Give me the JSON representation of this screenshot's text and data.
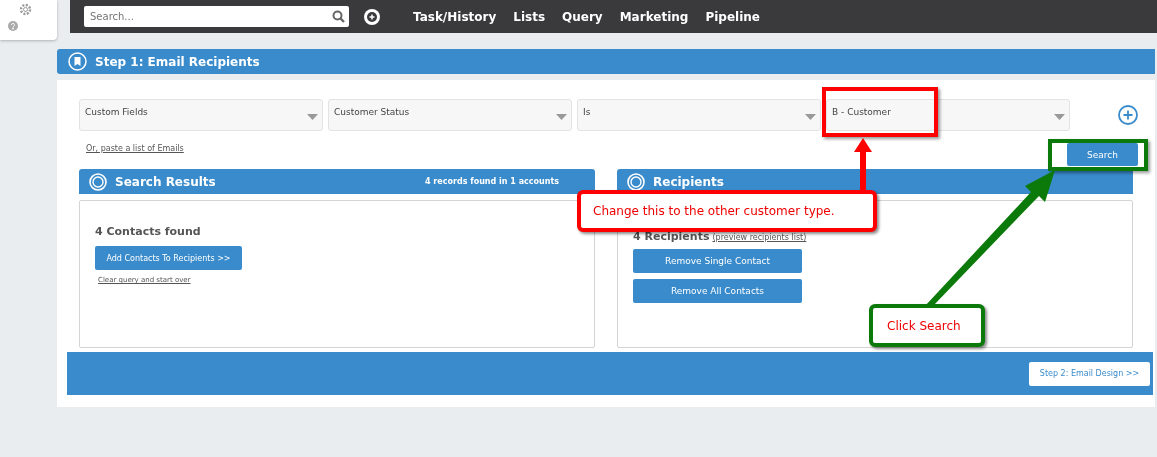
{
  "top_bar": {
    "search": {
      "placeholder": "Search..."
    },
    "nav": [
      "Task/History",
      "Lists",
      "Query",
      "Marketing",
      "Pipeline"
    ]
  },
  "step_header": {
    "title": "Step 1: Email Recipients"
  },
  "filters": [
    {
      "value": "Custom Fields"
    },
    {
      "value": "Customer Status"
    },
    {
      "value": "Is"
    },
    {
      "value": "B - Customer"
    }
  ],
  "paste_link": "Or, paste a list of Emails",
  "search_button": "Search",
  "results_panel": {
    "title": "Search Results",
    "summary": "4 records found in 1 accounts",
    "found": "4 Contacts found",
    "add_button": "Add Contacts To Recipients >>",
    "clear_link": "Clear query and start over"
  },
  "recipients_panel": {
    "title": "Recipients",
    "count": "4 Recipients",
    "preview_link": "(preview recipients list)",
    "buttons": [
      "Remove Single Contact",
      "Remove All Contacts"
    ]
  },
  "next_button": "Step 2: Email Design >>",
  "annotations": [
    {
      "kind": "red",
      "text": "Change this to the other customer type."
    },
    {
      "kind": "green",
      "text": "Click Search"
    }
  ]
}
